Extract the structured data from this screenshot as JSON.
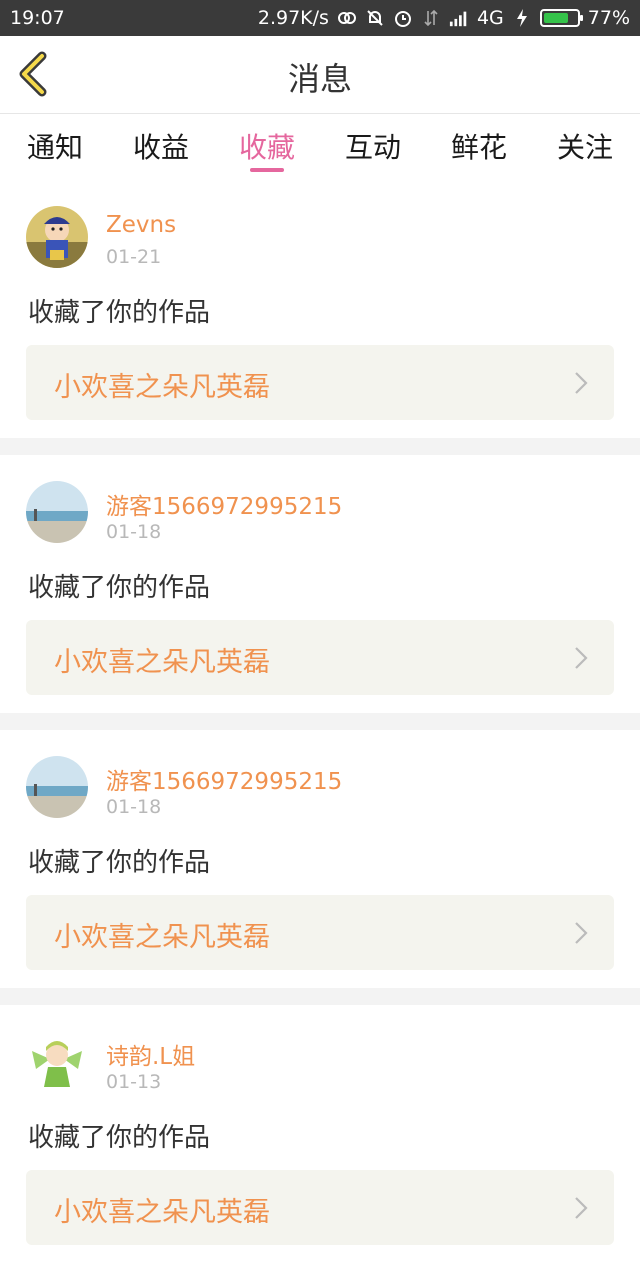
{
  "status_bar": {
    "time": "19:07",
    "network_speed": "2.97K/s",
    "network_type": "4G",
    "battery_text": "77%",
    "battery_level": 0.77,
    "icons": [
      "link-icon",
      "mute-bell-icon",
      "alarm-icon",
      "data-arrows-icon",
      "signal-icon",
      "charging-icon"
    ]
  },
  "header": {
    "title": "消息",
    "back_icon": "chevron-left-icon"
  },
  "tabs": [
    {
      "label": "通知",
      "active": false
    },
    {
      "label": "收益",
      "active": false
    },
    {
      "label": "收藏",
      "active": true
    },
    {
      "label": "互动",
      "active": false
    },
    {
      "label": "鲜花",
      "active": false
    },
    {
      "label": "关注",
      "active": false
    }
  ],
  "colors": {
    "accent": "#e5679e",
    "username": "#f0924f",
    "date": "#b8b8b8",
    "card_box": "#f4f4ee",
    "divider": "#f3f3f3"
  },
  "feed": [
    {
      "username": "Zevns",
      "date": "01-21",
      "action": "收藏了你的作品",
      "work_title": "小欢喜之朵凡英磊",
      "avatar": "cartoon-boy-avatar"
    },
    {
      "username": "游客1566972995215",
      "date": "01-18",
      "action": "收藏了你的作品",
      "work_title": "小欢喜之朵凡英磊",
      "avatar": "beach-avatar"
    },
    {
      "username": "游客1566972995215",
      "date": "01-18",
      "action": "收藏了你的作品",
      "work_title": "小欢喜之朵凡英磊",
      "avatar": "beach-avatar"
    },
    {
      "username": "诗韵.L姐",
      "date": "01-13",
      "action": "收藏了你的作品",
      "work_title": "小欢喜之朵凡英磊",
      "avatar": "fairy-avatar"
    }
  ]
}
